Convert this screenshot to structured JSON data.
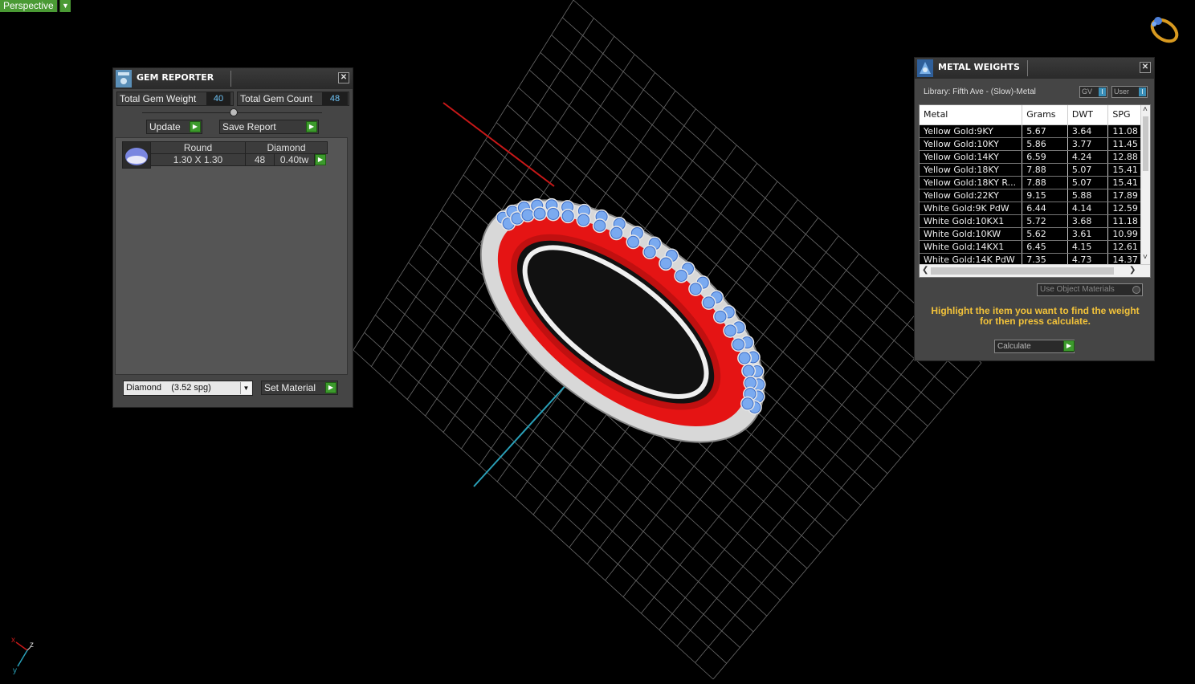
{
  "viewport": {
    "view_mode": "Perspective"
  },
  "gem_reporter": {
    "title": "GEM REPORTER",
    "total_gem_weight_label": "Total Gem Weight",
    "total_gem_weight_value": "40",
    "total_gem_count_label": "Total Gem Count",
    "total_gem_count_value": "48",
    "update_label": "Update",
    "save_report_label": "Save Report",
    "gem_row": {
      "shape": "Round",
      "material": "Diamond",
      "size": "1.30 X 1.30",
      "count": "48",
      "weight": "0.40tw"
    },
    "material_select": "Diamond    (3.52 spg)",
    "set_material_label": "Set Material"
  },
  "metal_weights": {
    "title": "METAL WEIGHTS",
    "library": "Library: Fifth Ave - (Slow)-Metal",
    "toggle_gv": "GV",
    "toggle_user": "User",
    "columns": [
      "Metal",
      "Grams",
      "DWT",
      "SPG"
    ],
    "rows": [
      [
        "Yellow Gold:9KY",
        "5.67",
        "3.64",
        "11.08"
      ],
      [
        "Yellow Gold:10KY",
        "5.86",
        "3.77",
        "11.45"
      ],
      [
        "Yellow Gold:14KY",
        "6.59",
        "4.24",
        "12.88"
      ],
      [
        "Yellow Gold:18KY",
        "7.88",
        "5.07",
        "15.41"
      ],
      [
        "Yellow Gold:18KY R...",
        "7.88",
        "5.07",
        "15.41"
      ],
      [
        "Yellow Gold:22KY",
        "9.15",
        "5.88",
        "17.89"
      ],
      [
        "White Gold:9K PdW",
        "6.44",
        "4.14",
        "12.59"
      ],
      [
        "White Gold:10KX1",
        "5.72",
        "3.68",
        "11.18"
      ],
      [
        "White Gold:10KW",
        "5.62",
        "3.61",
        "10.99"
      ],
      [
        "White Gold:14KX1",
        "6.45",
        "4.15",
        "12.61"
      ],
      [
        "White Gold:14K PdW",
        "7.35",
        "4.73",
        "14.37"
      ]
    ],
    "use_object_materials": "Use Object Materials",
    "instruction": "Highlight the item you want to find the weight for then press calculate.",
    "calculate_label": "Calculate"
  },
  "axis": {
    "x": "x",
    "z": "z",
    "y": "y"
  },
  "colors": {
    "accent_green": "#3c9a2c",
    "band_red": "#e01010",
    "stone_blue": "#7aaaf0",
    "instruction_yellow": "#f2c23a",
    "value_cyan": "#6fc3f5"
  }
}
